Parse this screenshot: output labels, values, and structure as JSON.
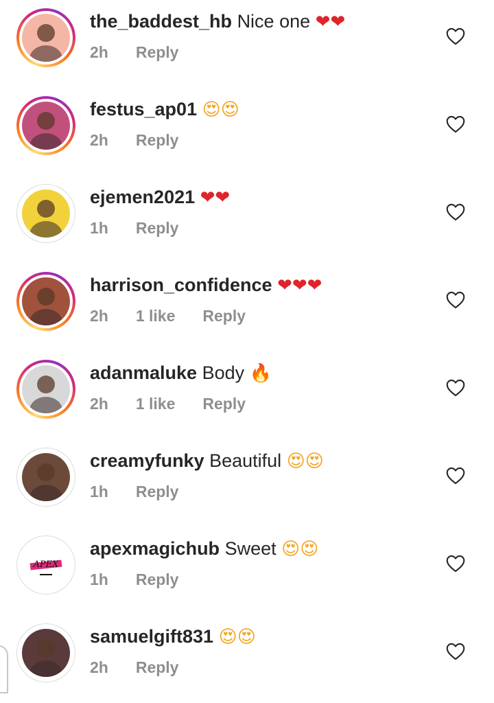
{
  "comments": [
    {
      "username": "the_baddest_hb",
      "text": "Nice one",
      "emoji": "❤❤",
      "emoji_kind": "heart-icon",
      "time": "2h",
      "likes": "",
      "reply": "Reply",
      "story_ring": true,
      "avatar_color": "#f4b6a6"
    },
    {
      "username": "festus_ap01",
      "text": "",
      "emoji": "😍😍",
      "emoji_kind": "heart-eyes-icon",
      "time": "2h",
      "likes": "",
      "reply": "Reply",
      "story_ring": true,
      "avatar_color": "#c2507d"
    },
    {
      "username": "ejemen2021",
      "text": "",
      "emoji": "❤❤",
      "emoji_kind": "heart-icon",
      "time": "1h",
      "likes": "",
      "reply": "Reply",
      "story_ring": false,
      "avatar_color": "#f2d23a"
    },
    {
      "username": "harrison_confidence",
      "text": "",
      "emoji": "❤❤❤",
      "emoji_kind": "heart-icon",
      "time": "2h",
      "likes": "1 like",
      "reply": "Reply",
      "story_ring": true,
      "avatar_color": "#a0523d"
    },
    {
      "username": "adanmaluke",
      "text": "Body",
      "emoji": "🔥",
      "emoji_kind": "fire-icon",
      "time": "2h",
      "likes": "1 like",
      "reply": "Reply",
      "story_ring": true,
      "avatar_color": "#d8d8d8"
    },
    {
      "username": "creamyfunky",
      "text": "Beautiful",
      "emoji": "😍😍",
      "emoji_kind": "heart-eyes-icon",
      "time": "1h",
      "likes": "",
      "reply": "Reply",
      "story_ring": false,
      "avatar_color": "#6b4a3a"
    },
    {
      "username": "apexmagichub",
      "text": "Sweet",
      "emoji": "😍😍",
      "emoji_kind": "heart-eyes-icon",
      "time": "1h",
      "likes": "",
      "reply": "Reply",
      "story_ring": false,
      "avatar_color": "#ffffff"
    },
    {
      "username": "samuelgift831",
      "text": "",
      "emoji": "😍😍",
      "emoji_kind": "heart-eyes-icon",
      "time": "2h",
      "likes": "",
      "reply": "Reply",
      "story_ring": false,
      "avatar_color": "#5a3a3a"
    }
  ],
  "apex_logo_text": "APEX"
}
